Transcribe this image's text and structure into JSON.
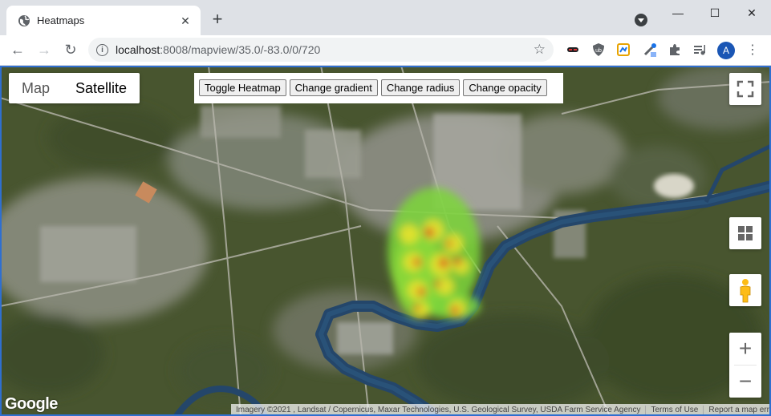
{
  "browser": {
    "tab_title": "Heatmaps",
    "url_host": "localhost",
    "url_rest": ":8008/mapview/35.0/-83.0/0/720",
    "avatar_letter": "A",
    "window_controls": [
      "—",
      "☐",
      "✕"
    ]
  },
  "map": {
    "map_type": {
      "map_label": "Map",
      "satellite_label": "Satellite",
      "selected": "Satellite"
    },
    "controls": [
      "Toggle Heatmap",
      "Change gradient",
      "Change radius",
      "Change opacity"
    ],
    "zoom_in": "+",
    "zoom_out": "−",
    "logo": "Google",
    "attribution": {
      "imagery": "Imagery ©2021 , Landsat / Copernicus, Maxar Technologies, U.S. Geological Survey, USDA Farm Service Agency",
      "terms": "Terms of Use",
      "report": "Report a map error"
    },
    "colors": {
      "river": "#24466a",
      "land": "#47552f",
      "heat_low": "#7dd63b",
      "heat_mid": "#e8e32d",
      "heat_high": "#d92a1c"
    }
  }
}
